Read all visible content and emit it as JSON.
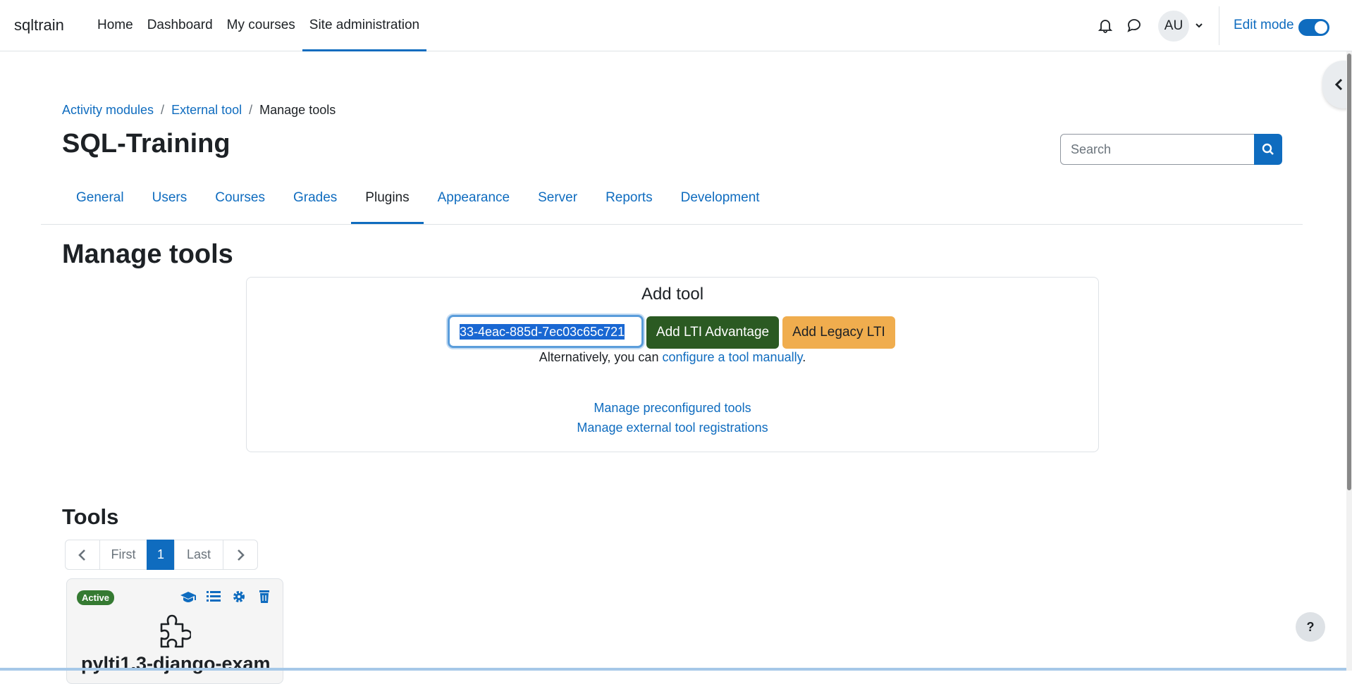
{
  "brand": "sqltrain",
  "primary_nav": [
    "Home",
    "Dashboard",
    "My courses",
    "Site administration"
  ],
  "user_initials": "AU",
  "edit_mode_label": "Edit mode",
  "breadcrumb": [
    "Activity modules",
    "External tool",
    "Manage tools"
  ],
  "breadcrumb_separator": "/",
  "page_heading": "SQL-Training",
  "search": {
    "placeholder": "Search"
  },
  "tabs": [
    "General",
    "Users",
    "Courses",
    "Grades",
    "Plugins",
    "Appearance",
    "Server",
    "Reports",
    "Development"
  ],
  "active_tab": "Plugins",
  "section_title": "Manage tools",
  "add_tool": {
    "title": "Add tool",
    "input_value": "33-4eac-885d-7ec03c65c721",
    "btn_lti_advantage": "Add LTI Advantage",
    "btn_legacy_lti": "Add Legacy LTI",
    "alt_prefix": "Alternatively, you can ",
    "alt_link": "configure a tool manually",
    "alt_suffix": ".",
    "link_preconfigured": "Manage preconfigured tools",
    "link_registrations": "Manage external tool registrations"
  },
  "tools_title": "Tools",
  "pagination": {
    "first": "First",
    "current": "1",
    "last": "Last"
  },
  "tool_card": {
    "status": "Active",
    "name": "pylti1.3-django-exam"
  },
  "help_label": "?",
  "colors": {
    "primary": "#0f6cbf",
    "success": "#2b5a22",
    "warning": "#f0ad4e",
    "active_badge": "#357a32"
  }
}
